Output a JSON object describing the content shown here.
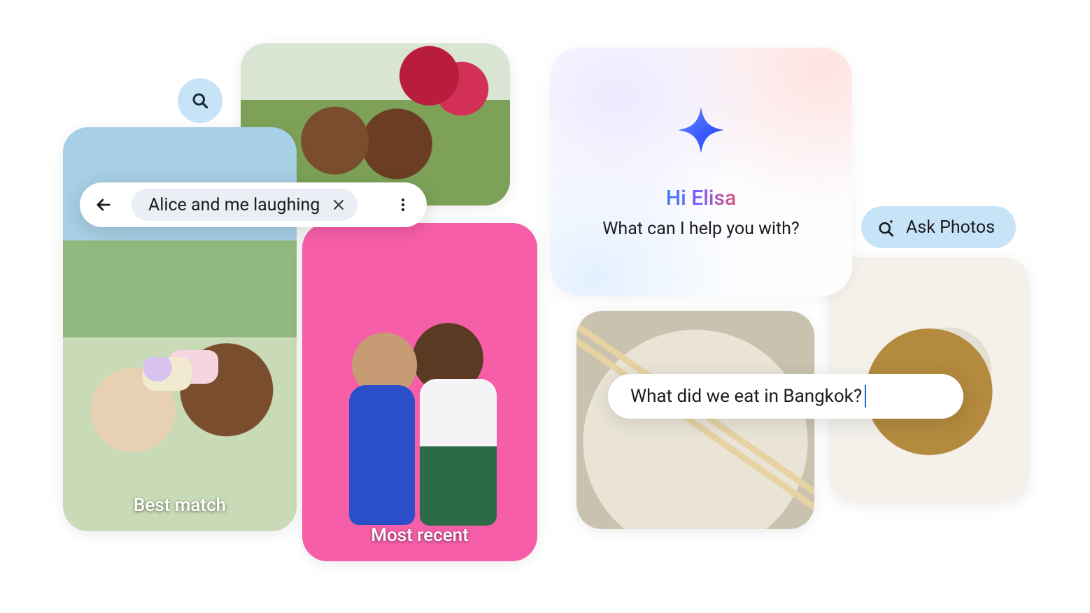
{
  "search": {
    "chip_text": "Alice and me laughing"
  },
  "thumbs": {
    "best_match": {
      "caption": "Best match"
    },
    "most_recent": {
      "caption": "Most recent"
    }
  },
  "hero": {
    "greeting": "Hi Elisa",
    "prompt": "What can I help you with?"
  },
  "ask_cta": {
    "label": "Ask Photos"
  },
  "query": {
    "text": "What did we eat in Bangkok?"
  }
}
